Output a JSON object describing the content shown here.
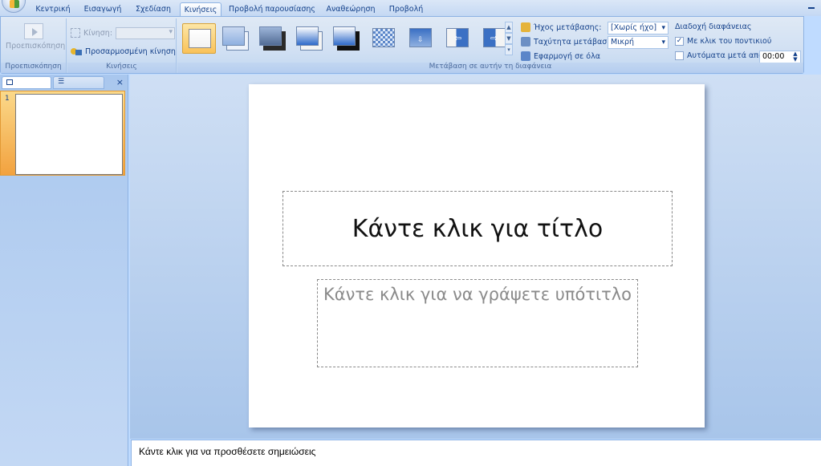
{
  "tabs": [
    "Κεντρική",
    "Εισαγωγή",
    "Σχεδίαση",
    "Κινήσεις",
    "Προβολή παρουσίασης",
    "Αναθεώρηση",
    "Προβολή"
  ],
  "active_tab": "Κινήσεις",
  "ribbon": {
    "preview": {
      "button_label": "Προεπισκόπηση",
      "group_label": "Προεπισκόπηση"
    },
    "animations": {
      "animate_label": "Κίνηση:",
      "custom_animation_label": "Προσαρμοσμένη κίνηση",
      "group_label": "Κινήσεις"
    },
    "transition": {
      "group_label": "Μετάβαση σε αυτήν τη διαφάνεια",
      "sound_label": "Ήχος μετάβασης:",
      "sound_value": "[Χωρίς ήχο]",
      "speed_label": "Ταχύτητα μετάβασης:",
      "speed_value": "Μικρή",
      "apply_all_label": "Εφαρμογή σε όλα",
      "thumbnails": [
        "no-transition",
        "fade-smoothly",
        "fade-through-black",
        "cut",
        "cut-through-black",
        "dissolve",
        "wipe-down",
        "wipe-left",
        "wipe-right"
      ]
    },
    "advance": {
      "title": "Διαδοχή διαφάνειας",
      "on_click_label": "Με κλικ του ποντικιού",
      "on_click_checked": true,
      "auto_label": "Αυτόματα μετά από:",
      "auto_checked": false,
      "auto_value": "00:00"
    }
  },
  "slides_pane": {
    "slide_number": "1"
  },
  "slide": {
    "title_placeholder": "Κάντε κλικ για τίτλο",
    "subtitle_placeholder": "Κάντε κλικ για να γράψετε υπότιτλο"
  },
  "notes": {
    "placeholder": "Κάντε κλικ για να προσθέσετε σημειώσεις"
  },
  "colors": {
    "accent": "#15428b",
    "ribbon_bg": "#d1e0f3",
    "selected": "#f9c259"
  }
}
